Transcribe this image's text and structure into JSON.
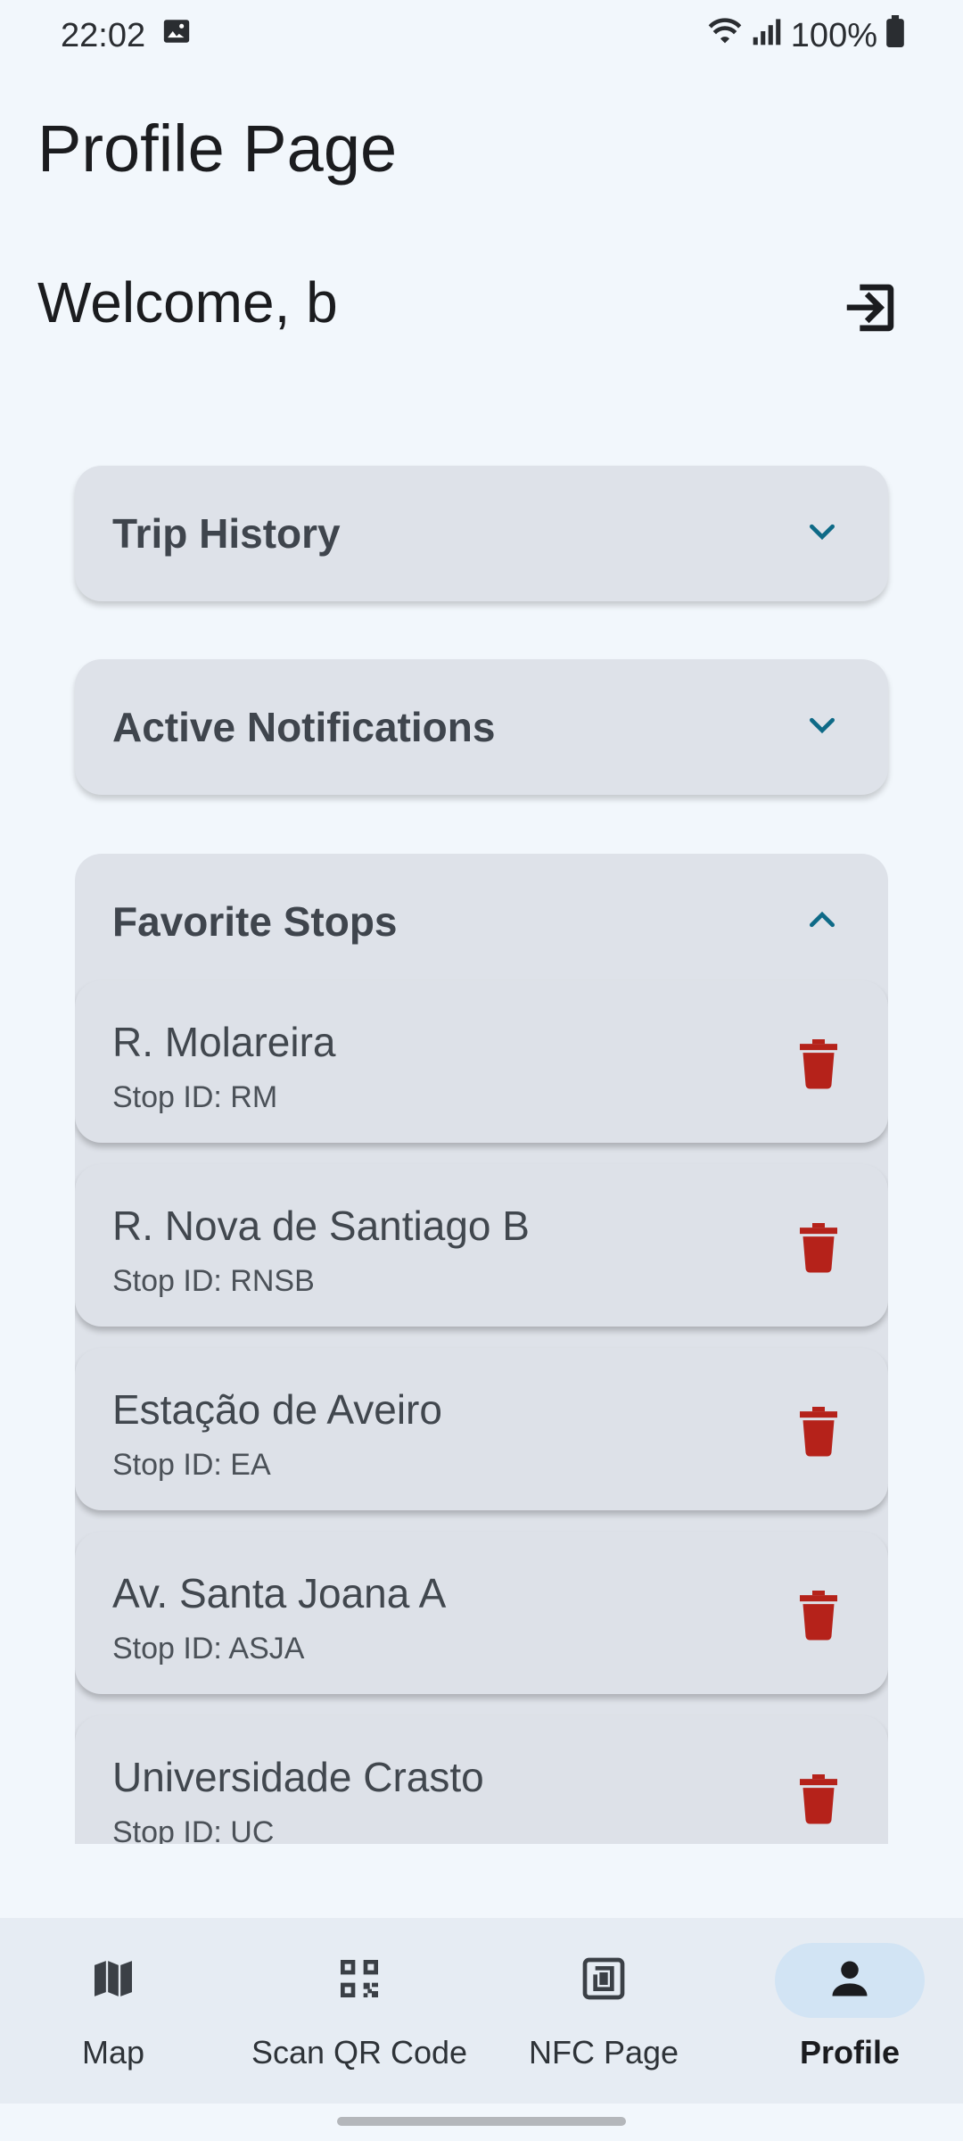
{
  "status_bar": {
    "time": "22:02",
    "battery": "100%",
    "icons": [
      "image-icon",
      "wifi-icon",
      "signal-icon",
      "battery-icon"
    ]
  },
  "page": {
    "title": "Profile Page",
    "welcome": "Welcome, b",
    "logout_icon": "logout-icon"
  },
  "sections": {
    "trip_history": {
      "title": "Trip History",
      "expanded": false
    },
    "active_notifications": {
      "title": "Active Notifications",
      "expanded": false
    },
    "favorite_stops": {
      "title": "Favorite Stops",
      "expanded": true,
      "items": [
        {
          "name": "R. Molareira",
          "stop_id": "Stop ID: RM"
        },
        {
          "name": "R. Nova de Santiago B",
          "stop_id": "Stop ID: RNSB"
        },
        {
          "name": "Estação de Aveiro",
          "stop_id": "Stop ID: EA"
        },
        {
          "name": "Av. Santa Joana A",
          "stop_id": "Stop ID: ASJA"
        },
        {
          "name": "Universidade Crasto",
          "stop_id": "Stop ID: UC"
        }
      ]
    }
  },
  "bottom_nav": {
    "items": [
      {
        "label": "Map",
        "icon": "map-icon"
      },
      {
        "label": "Scan QR Code",
        "icon": "qr-code-icon"
      },
      {
        "label": "NFC Page",
        "icon": "nfc-icon"
      },
      {
        "label": "Profile",
        "icon": "person-icon"
      }
    ],
    "active": "Profile"
  },
  "colors": {
    "background": "#f2f7fc",
    "card": "#dee2e9",
    "accent": "#0e6a87",
    "delete": "#b5221a",
    "nav_active_pill": "#d2e4f4"
  }
}
